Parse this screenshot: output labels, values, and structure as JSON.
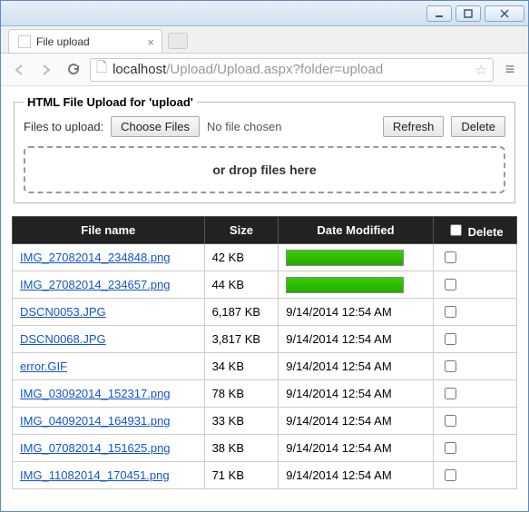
{
  "window": {
    "tab_title": "File upload",
    "url_prefix": "localhost",
    "url_rest": "/Upload/Upload.aspx?folder=upload"
  },
  "upload_panel": {
    "legend": "HTML File Upload for 'upload'",
    "label": "Files to upload:",
    "choose_btn": "Choose Files",
    "no_file": "No file chosen",
    "refresh_btn": "Refresh",
    "delete_btn": "Delete",
    "dropzone": "or drop files here"
  },
  "table": {
    "headers": {
      "name": "File name",
      "size": "Size",
      "date": "Date Modified",
      "delete": "Delete"
    },
    "rows": [
      {
        "name": "IMG_27082014_234848.png",
        "size": "42 KB",
        "date_progress": 100
      },
      {
        "name": "IMG_27082014_234657.png",
        "size": "44 KB",
        "date_progress": 100
      },
      {
        "name": "DSCN0053.JPG",
        "size": "6,187 KB",
        "date": "9/14/2014 12:54 AM"
      },
      {
        "name": "DSCN0068.JPG",
        "size": "3,817 KB",
        "date": "9/14/2014 12:54 AM"
      },
      {
        "name": "error.GIF",
        "size": "34 KB",
        "date": "9/14/2014 12:54 AM"
      },
      {
        "name": "IMG_03092014_152317.png",
        "size": "78 KB",
        "date": "9/14/2014 12:54 AM"
      },
      {
        "name": "IMG_04092014_164931.png",
        "size": "33 KB",
        "date": "9/14/2014 12:54 AM"
      },
      {
        "name": "IMG_07082014_151625.png",
        "size": "38 KB",
        "date": "9/14/2014 12:54 AM"
      },
      {
        "name": "IMG_11082014_170451.png",
        "size": "71 KB",
        "date": "9/14/2014 12:54 AM"
      }
    ]
  }
}
